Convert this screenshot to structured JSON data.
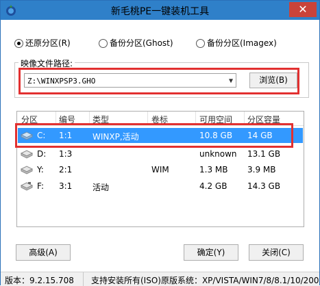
{
  "window": {
    "title": "新毛桃PE一键装机工具",
    "close_glyph": "✕"
  },
  "modes": [
    {
      "label": "还原分区(R)",
      "selected": true
    },
    {
      "label": "备份分区(Ghost)",
      "selected": false
    },
    {
      "label": "备份分区(Imagex)",
      "selected": false
    }
  ],
  "image_path": {
    "group_label": "映像文件路径:",
    "value": "Z:\\WINXPSP3.GHO",
    "browse_label": "浏览(B)"
  },
  "table": {
    "columns": [
      "分区",
      "编号",
      "类型",
      "卷标",
      "可用空间",
      "分区容量"
    ],
    "rows": [
      {
        "drive": "C:",
        "num": "1:1",
        "type": "WINXP,活动",
        "label": "",
        "free": "10.8 GB",
        "size": "14 GB",
        "selected": true
      },
      {
        "drive": "D:",
        "num": "1:3",
        "type": "",
        "label": "",
        "free": "unknown",
        "size": "13.1 GB",
        "selected": false
      },
      {
        "drive": "Y:",
        "num": "2:1",
        "type": "",
        "label": "WIM",
        "free": "1.3 MB",
        "size": "3.9 MB",
        "selected": false
      },
      {
        "drive": "F:",
        "num": "3:1",
        "type": "活动",
        "label": "",
        "free": "4.2 GB",
        "size": "14.3 GB",
        "selected": false
      }
    ]
  },
  "buttons": {
    "advanced": "高级(A)",
    "ok": "确定(Y)",
    "close": "关闭(C)"
  },
  "status": {
    "version": "版本：9.2.15.708",
    "support": "支持安装所有(ISO)原版系统：XP/VISTA/WIN7/8/8.1/10/200"
  },
  "colors": {
    "titlebar": "#2f80c9",
    "selection": "#3399ff",
    "highlight_box": "#e23030"
  }
}
